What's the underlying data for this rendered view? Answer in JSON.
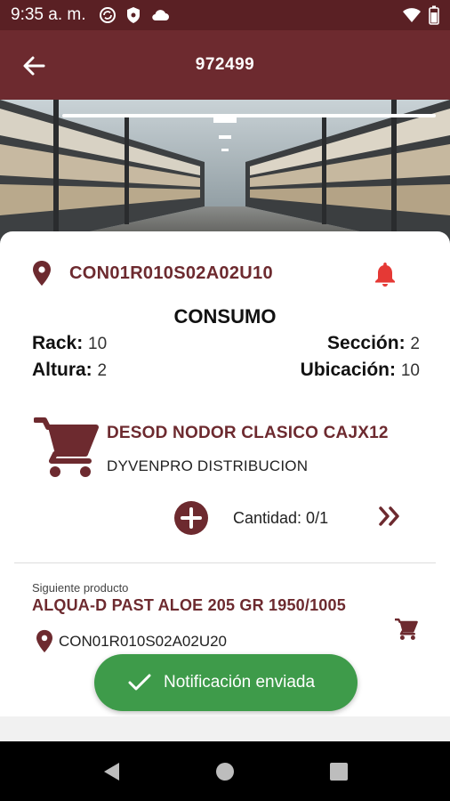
{
  "status_bar": {
    "time": "9:35 a. m.",
    "icons": [
      "sync-icon",
      "shield-icon",
      "cloud-icon",
      "wifi-icon",
      "battery-icon"
    ]
  },
  "app_bar": {
    "title": "972499",
    "back_icon": "arrow-left-icon"
  },
  "theme": {
    "primary": "#6d2a2f",
    "status_bar": "#5a2024",
    "alert_red": "#e53935",
    "toast_green": "#3e9b4a"
  },
  "location": {
    "code": "CON01R010S02A02U10",
    "area": "CONSUMO",
    "rack_label": "Rack:",
    "rack_value": "10",
    "altura_label": "Altura:",
    "altura_value": "2",
    "seccion_label": "Sección:",
    "seccion_value": "2",
    "ubicacion_label": "Ubicación:",
    "ubicacion_value": "10"
  },
  "product": {
    "name": "DESOD NODOR CLASICO CAJX12",
    "distributor": "DYVENPRO DISTRIBUCION",
    "quantity_text": "Cantidad: 0/1"
  },
  "next_product": {
    "label": "Siguiente producto",
    "name": "ALQUA-D PAST ALOE 205 GR 1950/1005",
    "location": "CON01R010S02A02U20"
  },
  "toast": {
    "message": "Notificación enviada"
  }
}
